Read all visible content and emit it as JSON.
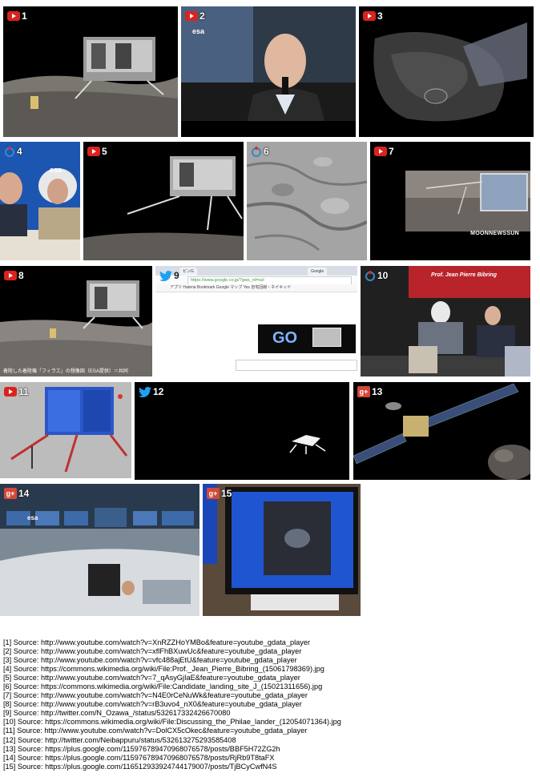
{
  "tiles": [
    {
      "num": "1",
      "source": "youtube",
      "icon": "youtube-icon"
    },
    {
      "num": "2",
      "source": "youtube",
      "icon": "youtube-icon",
      "logo": "esa"
    },
    {
      "num": "3",
      "source": "youtube",
      "icon": "youtube-icon"
    },
    {
      "num": "4",
      "source": "wikimedia",
      "icon": "wikimedia-icon",
      "logo": "esa"
    },
    {
      "num": "5",
      "source": "youtube",
      "icon": "youtube-icon"
    },
    {
      "num": "6",
      "source": "wikimedia",
      "icon": "wikimedia-icon"
    },
    {
      "num": "7",
      "source": "youtube",
      "icon": "youtube-icon",
      "overlay": "MOONNEWSSUN"
    },
    {
      "num": "8",
      "source": "youtube",
      "icon": "youtube-icon",
      "caption": "着陸した着陸機「フィラエ」の想像図（ESA提供）＝共同"
    },
    {
      "num": "9",
      "source": "twitter",
      "icon": "twitter-icon",
      "browser": {
        "tab1": "ピンG",
        "tab2": "Google",
        "url": "https://www.google.co.jp/?gws_rd=ssl",
        "bookmarks": "アプリ   Hatena Bookmark   Google マップ   Yes 自宅回線・ネイキッド",
        "doodle": "GO"
      }
    },
    {
      "num": "10",
      "source": "wikimedia",
      "icon": "wikimedia-icon",
      "banner": "Prof. Jean Pierre Bibring"
    },
    {
      "num": "11",
      "source": "youtube",
      "icon": "youtube-icon"
    },
    {
      "num": "12",
      "source": "twitter",
      "icon": "twitter-icon"
    },
    {
      "num": "13",
      "source": "googleplus",
      "icon": "googleplus-icon"
    },
    {
      "num": "14",
      "source": "googleplus",
      "icon": "googleplus-icon",
      "logo": "esa"
    },
    {
      "num": "15",
      "source": "googleplus",
      "icon": "googleplus-icon"
    }
  ],
  "googleplus_label": "g+",
  "sources": [
    "[1] Source: http://www.youtube.com/watch?v=XnRZZHoYMBo&feature=youtube_gdata_player",
    "[2] Source: http://www.youtube.com/watch?v=xflFhBXuwUc&feature=youtube_gdata_player",
    "[3] Source: http://www.youtube.com/watch?v=vfc488ajEtU&feature=youtube_gdata_player",
    "[4] Source: https://commons.wikimedia.org/wiki/File:Prof._Jean_Pierre_Bibring_(15061798369).jpg",
    "[5] Source: http://www.youtube.com/watch?v=7_qAsyGjIaE&feature=youtube_gdata_player",
    "[6] Source: https://commons.wikimedia.org/wiki/File:Candidate_landing_site_J_(15021311656).jpg",
    "[7] Source: http://www.youtube.com/watch?v=N4E0rCeNuWk&feature=youtube_gdata_player",
    "[8] Source: http://www.youtube.com/watch?v=rB3uvo4_nX0&feature=youtube_gdata_player",
    "[9] Source: http://twitter.com/N_Ozawa_/status/532617332426670080",
    "[10] Source: https://commons.wikimedia.org/wiki/File:Discussing_the_Philae_lander_(12054071364).jpg",
    "[11] Source: http://www.youtube.com/watch?v=DolCX5cOkec&feature=youtube_gdata_player",
    "[12] Source: http://twitter.com/Neibappuru/status/532613275293585408",
    "[13] Source: https://plus.google.com/115976789470968076578/posts/BBF5H72ZG2h",
    "[14] Source: https://plus.google.com/115976789470968076578/posts/RjRb9T8taFX",
    "[15] Source: https://plus.google.com/116512933924744179007/posts/TjBCyCwfN4S"
  ]
}
